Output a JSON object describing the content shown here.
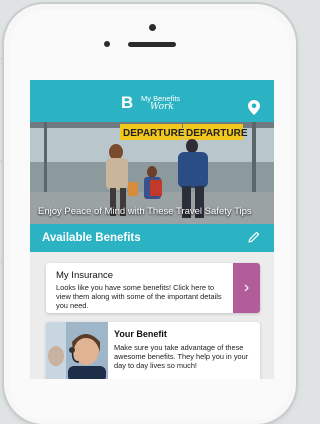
{
  "app": {
    "logo_mark": "B",
    "logo_line1": "My Benefits",
    "logo_line2": "Work"
  },
  "hero": {
    "sign_left": "DEPARTURE",
    "sign_right": "DEPARTURE",
    "caption": "Enjoy Peace of Mind with These Travel Safety Tips"
  },
  "available": {
    "title": "Available Benefits"
  },
  "insurance_card": {
    "title": "My Insurance",
    "text": "Looks like you have some benefits! Click here to view them along with some of the important details you need.",
    "arrow": "›"
  },
  "benefit_card": {
    "title": "Your Benefit",
    "text": "Make sure you take advantage of these awesome benefits. They help you in your day to day lives so much!"
  },
  "icons": {
    "location": "location-pin-icon",
    "edit": "pencil-icon",
    "arrow": "chevron-right-icon"
  },
  "colors": {
    "teal": "#2bb3c4",
    "arrow_card": "#b25c9a"
  }
}
